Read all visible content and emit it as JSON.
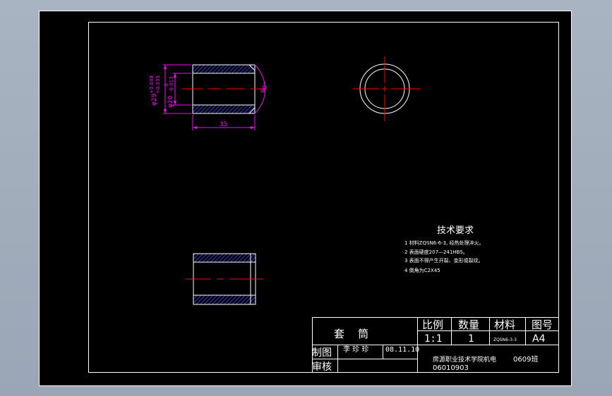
{
  "drawing": {
    "title": "套    筒",
    "dimensions": {
      "outer_diameter": "φ29",
      "outer_tol_upper": "+0.048",
      "outer_tol_lower": "+0.035",
      "inner_diameter": "φ20",
      "inner_tol_upper": "0",
      "inner_tol_lower": "-0.013",
      "length": "35",
      "angle": "90°"
    },
    "requirements": {
      "heading": "技术要求",
      "items": [
        "1  材料ZQSN6-6-3, 经热处理淬火。",
        "2  表面硬度207—241HBS。",
        "3  表面不得产生开裂、变形或裂纹。",
        "4  倒角为C2X45"
      ]
    },
    "title_block": {
      "scale_label": "比例",
      "qty_label": "数量",
      "material_label": "材料",
      "drawing_no_label": "图号",
      "scale": "1:1",
      "qty": "1",
      "material": "ZQSN6-3-3",
      "drawing_no": "A4",
      "drawn_by_label": "制图",
      "checked_by_label": "审核",
      "drawn_by": "李 珍 珍",
      "date": "08.11.10",
      "school": "房源职业技术学院机电",
      "class": "0609班",
      "student_no": "06010903"
    }
  },
  "colors": {
    "background": "#000000",
    "frame": "#ffffff",
    "dimension": "#ff00ff",
    "centerline": "#ff0000",
    "hatch": "#3a4dff"
  }
}
